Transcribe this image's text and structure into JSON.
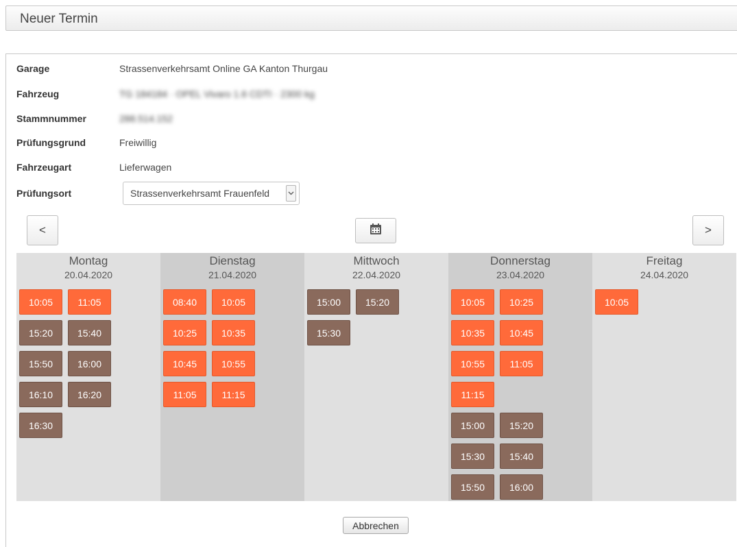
{
  "header": {
    "title": "Neuer Termin"
  },
  "form": {
    "rows": [
      {
        "label": "Garage",
        "value": "Strassenverkehrsamt Online GA Kanton Thurgau"
      },
      {
        "label": "Fahrzeug",
        "value": "TG 184184 · OPEL Vivaro 1.6 CDTI · 2300 kg"
      },
      {
        "label": "Stammnummer",
        "value": "288.514.152"
      },
      {
        "label": "Prüfungsgrund",
        "value": "Freiwillig"
      },
      {
        "label": "Fahrzeugart",
        "value": "Lieferwagen"
      }
    ],
    "pruefungsort_label": "Prüfungsort",
    "pruefungsort_value": "Strassenverkehrsamt Frauenfeld"
  },
  "nav": {
    "prev": "<",
    "next": ">",
    "calendar_icon": "calendar-icon"
  },
  "colors": {
    "available": "#ff6a3a",
    "other": "#8a6a5c"
  },
  "days": [
    {
      "name": "Montag",
      "date": "20.04.2020",
      "slots": [
        {
          "time": "10:05",
          "kind": "orange"
        },
        {
          "time": "11:05",
          "kind": "orange"
        },
        {
          "time": "15:20",
          "kind": "brown"
        },
        {
          "time": "15:40",
          "kind": "brown"
        },
        {
          "time": "15:50",
          "kind": "brown"
        },
        {
          "time": "16:00",
          "kind": "brown"
        },
        {
          "time": "16:10",
          "kind": "brown"
        },
        {
          "time": "16:20",
          "kind": "brown"
        },
        {
          "time": "16:30",
          "kind": "brown"
        }
      ]
    },
    {
      "name": "Dienstag",
      "date": "21.04.2020",
      "slots": [
        {
          "time": "08:40",
          "kind": "orange"
        },
        {
          "time": "10:05",
          "kind": "orange"
        },
        {
          "time": "10:25",
          "kind": "orange"
        },
        {
          "time": "10:35",
          "kind": "orange"
        },
        {
          "time": "10:45",
          "kind": "orange"
        },
        {
          "time": "10:55",
          "kind": "orange"
        },
        {
          "time": "11:05",
          "kind": "orange"
        },
        {
          "time": "11:15",
          "kind": "orange"
        }
      ]
    },
    {
      "name": "Mittwoch",
      "date": "22.04.2020",
      "slots": [
        {
          "time": "15:00",
          "kind": "brown"
        },
        {
          "time": "15:20",
          "kind": "brown"
        },
        {
          "time": "15:30",
          "kind": "brown"
        }
      ]
    },
    {
      "name": "Donnerstag",
      "date": "23.04.2020",
      "slots": [
        {
          "time": "10:05",
          "kind": "orange"
        },
        {
          "time": "10:25",
          "kind": "orange"
        },
        {
          "time": "10:35",
          "kind": "orange"
        },
        {
          "time": "10:45",
          "kind": "orange"
        },
        {
          "time": "10:55",
          "kind": "orange"
        },
        {
          "time": "11:05",
          "kind": "orange"
        },
        {
          "time": "11:15",
          "kind": "orange"
        },
        {
          "time": "",
          "kind": "spacer"
        },
        {
          "time": "15:00",
          "kind": "brown"
        },
        {
          "time": "15:20",
          "kind": "brown"
        },
        {
          "time": "15:30",
          "kind": "brown"
        },
        {
          "time": "15:40",
          "kind": "brown"
        },
        {
          "time": "15:50",
          "kind": "brown"
        },
        {
          "time": "16:00",
          "kind": "brown"
        }
      ]
    },
    {
      "name": "Freitag",
      "date": "24.04.2020",
      "slots": [
        {
          "time": "10:05",
          "kind": "orange"
        }
      ]
    }
  ],
  "actions": {
    "cancel": "Abbrechen"
  }
}
